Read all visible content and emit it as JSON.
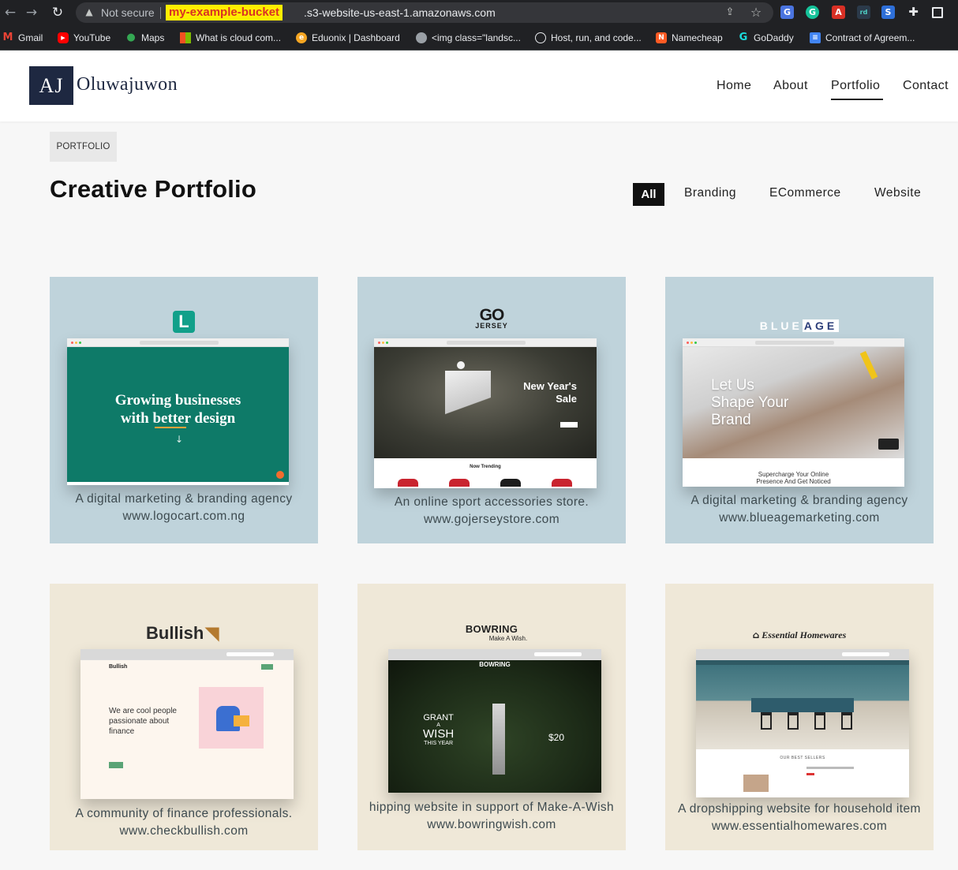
{
  "browser": {
    "not_secure": "Not secure",
    "url_highlight": "my-example-bucket",
    "url_rest": ".s3-website-us-east-1.amazonaws.com",
    "bookmarks": [
      {
        "label": "Gmail",
        "icon": "gmail-icon"
      },
      {
        "label": "YouTube",
        "icon": "youtube-icon"
      },
      {
        "label": "Maps",
        "icon": "maps-icon"
      },
      {
        "label": "What is cloud com...",
        "icon": "microsoft-icon"
      },
      {
        "label": "Eduonix | Dashboard",
        "icon": "eduonix-icon"
      },
      {
        "label": "<img class=\"landsc...",
        "icon": "globe-icon"
      },
      {
        "label": "Host, run, and code...",
        "icon": "replit-icon"
      },
      {
        "label": "Namecheap",
        "icon": "namecheap-icon"
      },
      {
        "label": "GoDaddy",
        "icon": "godaddy-icon"
      },
      {
        "label": "Contract of Agreem...",
        "icon": "docs-icon"
      }
    ]
  },
  "site": {
    "logo_initials": "AJ",
    "logo_name": "Oluwajuwon",
    "nav": [
      "Home",
      "About",
      "Portfolio",
      "Contact"
    ],
    "active_nav": "Portfolio"
  },
  "portfolio": {
    "tag": "PORTFOLIO",
    "title": "Creative Portfolio",
    "filters": [
      "All",
      "Branding",
      "ECommerce",
      "Website"
    ],
    "active_filter": "All",
    "items": [
      {
        "brand": "L",
        "hero": "Growing businesses with better design",
        "hero_line1": "Growing businesses",
        "hero_line2": "with better design",
        "desc": "A digital marketing & branding agency",
        "url": "www.logocart.com.ng"
      },
      {
        "brand": "GO",
        "brand_sub": "JERSEY",
        "hero_line1": "New Year's",
        "hero_line2": "Sale",
        "section": "Now Trending",
        "desc": "An online sport accessories store.",
        "url": "www.gojerseystore.com"
      },
      {
        "brand_a": "BLUE",
        "brand_b": "AGE",
        "hero_line1": "Let Us",
        "hero_line2": "Shape Your",
        "hero_line3": "Brand",
        "sub1": "Supercharge Your Online",
        "sub2": "Presence And Get Noticed",
        "desc": "A digital marketing & branding agency",
        "url": "www.blueagemarketing.com"
      },
      {
        "brand": "Bullish",
        "hero_line1": "We are cool people",
        "hero_line2": "passionate about",
        "hero_line3": "finance",
        "desc": "A community of finance professionals.",
        "url": "www.checkbullish.com"
      },
      {
        "brand": "BOWRING",
        "brand_sub": "Make A Wish.",
        "hero_line1": "GRANT",
        "hero_line2": "A",
        "hero_line3": "WISH",
        "hero_line4": "THIS YEAR",
        "price": "$20",
        "desc": "hipping website in support of Make-A-Wish",
        "url": "www.bowringwish.com"
      },
      {
        "brand": "Essential Homewares",
        "section": "OUR BEST SELLERS",
        "desc": "A dropshipping website for household item",
        "url": "www.essentialhomewares.com"
      }
    ]
  }
}
